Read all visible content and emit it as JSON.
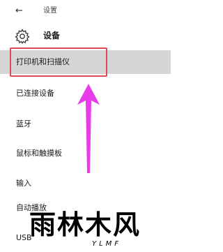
{
  "window": {
    "back_glyph": "←",
    "title": "设置"
  },
  "header": {
    "icon": "gear-icon",
    "title": "设备"
  },
  "nav": {
    "items": [
      {
        "label": "打印机和扫描仪",
        "selected": true
      },
      {
        "label": "已连接设备",
        "selected": false
      },
      {
        "label": "蓝牙",
        "selected": false
      },
      {
        "label": "鼠标和触摸板",
        "selected": false
      },
      {
        "label": "输入",
        "selected": false
      },
      {
        "label": "自动播放",
        "selected": false
      },
      {
        "label": "USB",
        "selected": false
      }
    ]
  },
  "watermark": {
    "text": "雨林木风",
    "sub": "YLMF"
  },
  "colors": {
    "highlight_box": "#e04a55",
    "arrow": "#e83ce8",
    "selected_bg": "#d6d6d6"
  }
}
